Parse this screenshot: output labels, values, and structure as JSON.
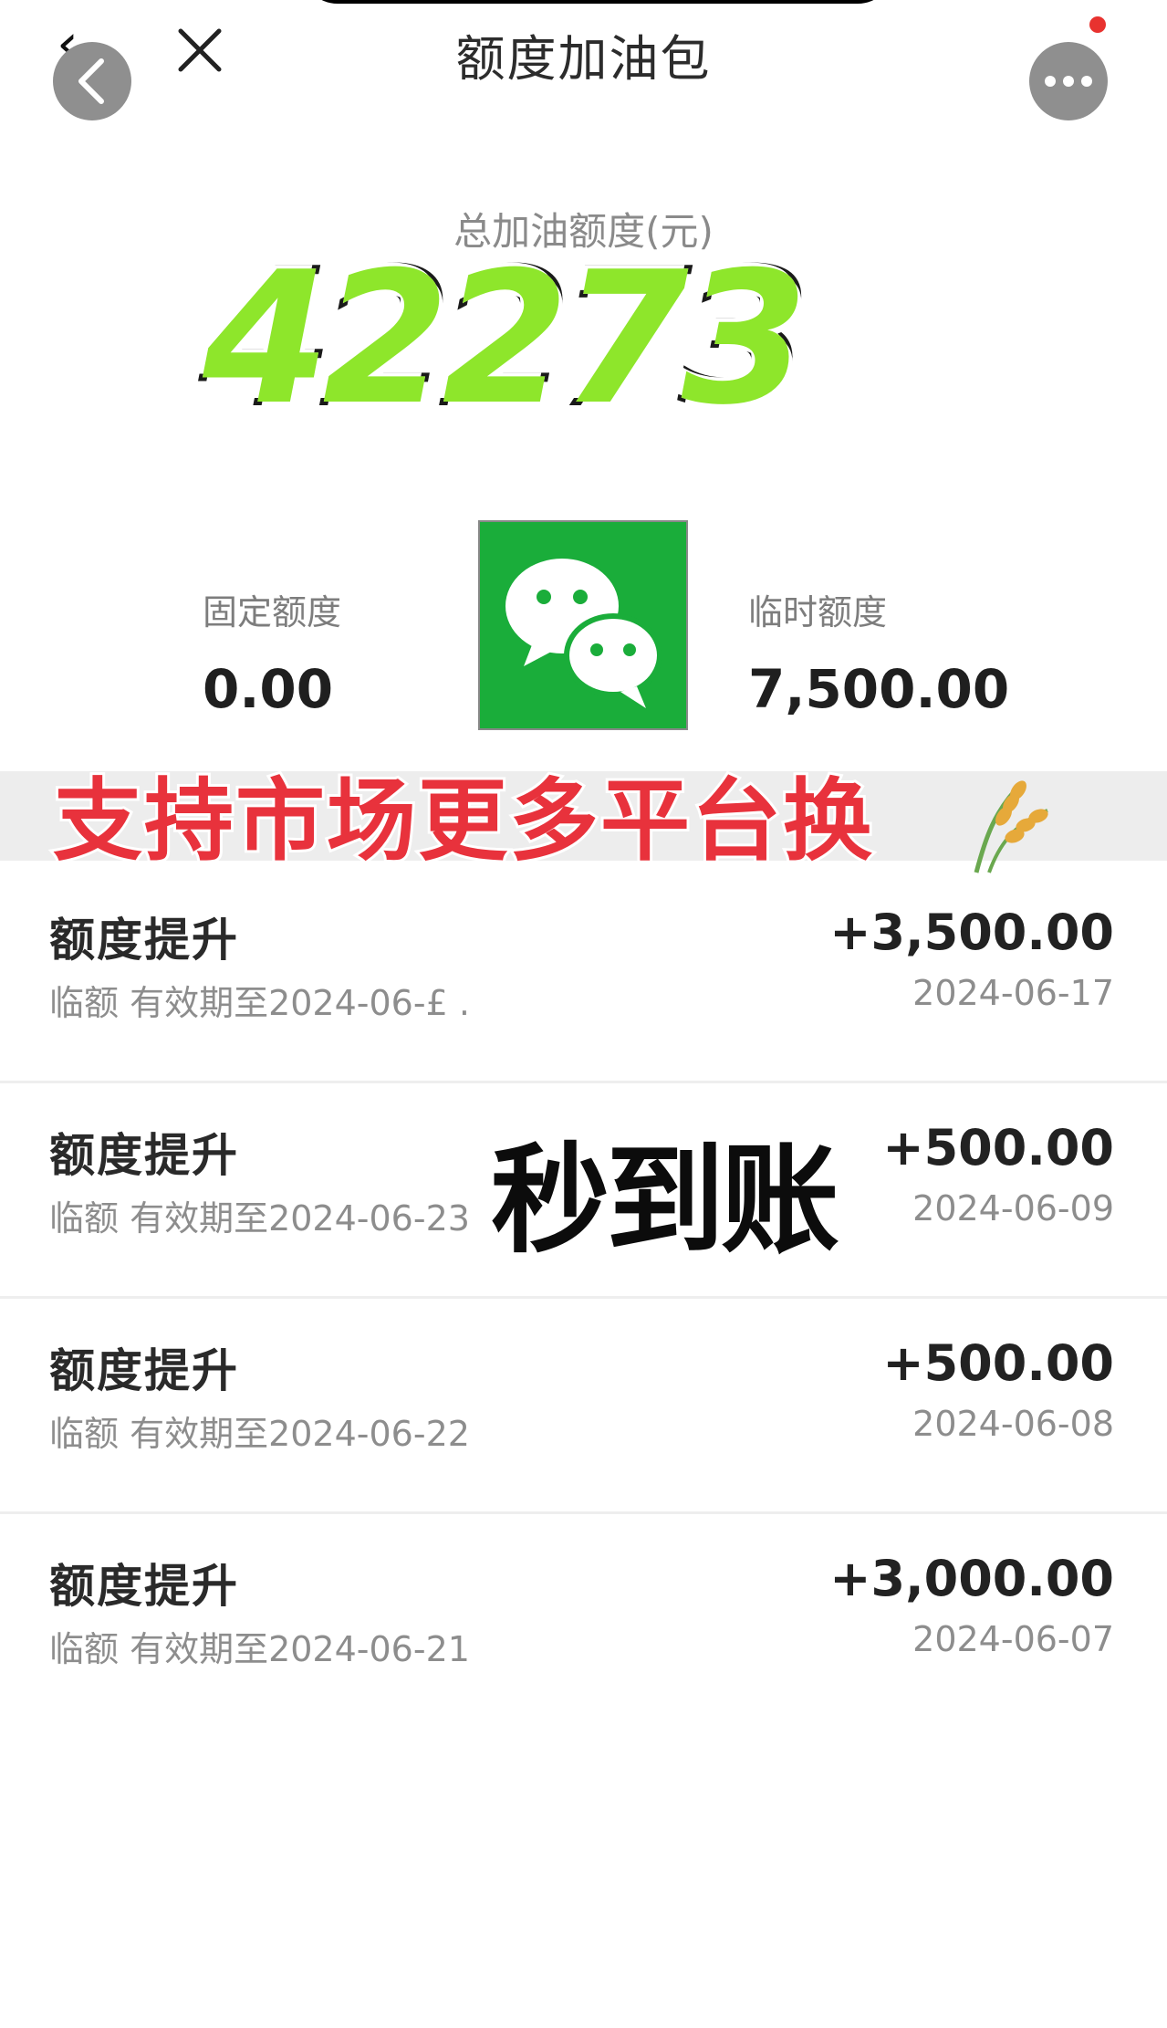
{
  "header": {
    "title": "额度加油包",
    "back_glyph": "‹"
  },
  "summary": {
    "total_label": "总加油额度(元)",
    "total_amount": "42273",
    "fixed_label": "固定额度",
    "fixed_value": "0.00",
    "temp_label": "临时额度",
    "temp_value": "7,500.00"
  },
  "promo": {
    "text": "支持市场更多平台换",
    "overlay_text": "秒到账"
  },
  "records": [
    {
      "title": "额度提升",
      "subtitle": "临额 有效期至2024-06-£ .",
      "amount": "+3,500.00",
      "date": "2024-06-17"
    },
    {
      "title": "额度提升",
      "subtitle": "临额 有效期至2024-06-23",
      "amount": "+500.00",
      "date": "2024-06-09"
    },
    {
      "title": "额度提升",
      "subtitle": "临额 有效期至2024-06-22",
      "amount": "+500.00",
      "date": "2024-06-08"
    },
    {
      "title": "额度提升",
      "subtitle": "临额 有效期至2024-06-21",
      "amount": "+3,000.00",
      "date": "2024-06-07"
    }
  ],
  "icons": {
    "back": "back-icon",
    "close": "close-icon",
    "more": "more-icon",
    "logo": "wechat-icon",
    "wheat": "wheat-icon"
  },
  "colors": {
    "accent_green": "#8ee62b",
    "promo_red": "#e8323c",
    "wechat_green": "#1aad3a",
    "notification_red": "#e8322f"
  }
}
